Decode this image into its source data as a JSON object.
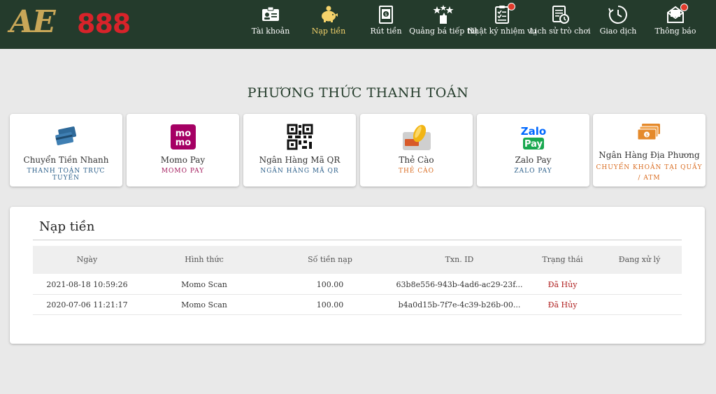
{
  "brand": {
    "logo_letters": "AE",
    "logo_number": "888"
  },
  "nav": {
    "items": [
      {
        "label": "Tài khoản",
        "icon": "account-card-icon",
        "active": false,
        "badge": false
      },
      {
        "label": "Nạp tiền",
        "icon": "piggy-bank-icon",
        "active": true,
        "badge": false
      },
      {
        "label": "Rút tiền",
        "icon": "withdraw-icon",
        "active": false,
        "badge": false
      },
      {
        "label": "Quảng bá tiếp thị",
        "icon": "marketing-icon",
        "active": false,
        "badge": false
      },
      {
        "label": "Nhật ký nhiệm vụ",
        "icon": "task-list-icon",
        "active": false,
        "badge": true
      },
      {
        "label": "Lịch sử trò chơi",
        "icon": "game-history-icon",
        "active": false,
        "badge": false
      },
      {
        "label": "Giao dịch",
        "icon": "clock-icon",
        "active": false,
        "badge": false
      },
      {
        "label": "Thông báo",
        "icon": "mail-icon",
        "active": false,
        "badge": true
      }
    ]
  },
  "payment": {
    "section_title": "PHƯƠNG THỨC THANH TOÁN",
    "methods": [
      {
        "name": "Chuyển Tiền Nhanh",
        "sub": "THANH TOÁN TRỰC TUYẾN",
        "sub_color": "#2b5f8a",
        "icon": "credit-cards-icon"
      },
      {
        "name": "Momo Pay",
        "sub": "MOMO PAY",
        "sub_color": "#a3195b",
        "icon": "momo-logo-icon",
        "logo_text": "mo mo"
      },
      {
        "name": "Ngân Hàng Mã QR",
        "sub": "NGÂN HÀNG MÃ QR",
        "sub_color": "#2b5f8a",
        "icon": "qr-code-icon"
      },
      {
        "name": "Thẻ Cào",
        "sub": "THẺ CÀO",
        "sub_color": "#d96b1f",
        "icon": "scratch-card-icon"
      },
      {
        "name": "Zalo Pay",
        "sub": "ZALO PAY",
        "sub_color": "#2b5f8a",
        "icon": "zalopay-logo-icon",
        "logo_top": "Zalo",
        "logo_bottom": "Pay"
      },
      {
        "name": "Ngân Hàng Địa Phương",
        "sub": "CHUYỂN KHOẢN TẠI QUẦY / ATM",
        "sub_color": "#d96b1f",
        "icon": "banknotes-icon"
      }
    ]
  },
  "deposits": {
    "title": "Nạp tiền",
    "columns": [
      "Ngày",
      "Hình thức",
      "Số tiền nạp",
      "Txn. ID",
      "Trạng thái",
      "Đang xử lý"
    ],
    "rows": [
      {
        "date": "2021-08-18 10:59:26",
        "method": "Momo Scan",
        "amount": "100.00",
        "txn": "63b8e556-943b-4ad6-ac29-23f...",
        "status": "Đã Hủy",
        "processing": ""
      },
      {
        "date": "2020-07-06 11:21:17",
        "method": "Momo Scan",
        "amount": "100.00",
        "txn": "b4a0d15b-7f7e-4c39-b26b-00...",
        "status": "Đã Hủy",
        "processing": ""
      }
    ]
  }
}
